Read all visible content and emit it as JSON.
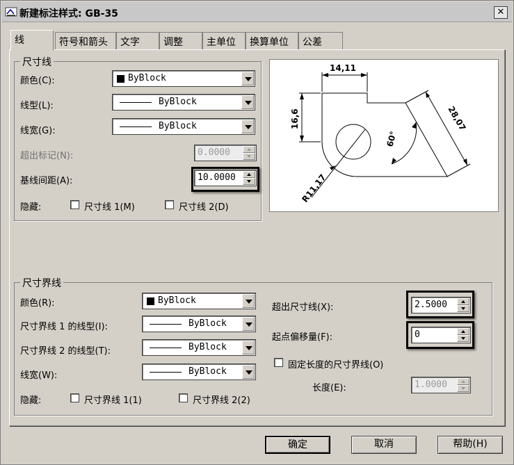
{
  "window": {
    "title": "新建标注样式: GB-35",
    "close_label": "✕"
  },
  "tabs": [
    {
      "label": "线"
    },
    {
      "label": "符号和箭头"
    },
    {
      "label": "文字"
    },
    {
      "label": "调整"
    },
    {
      "label": "主单位"
    },
    {
      "label": "换算单位"
    },
    {
      "label": "公差"
    }
  ],
  "dim_lines": {
    "legend": "尺寸线",
    "color_label": "颜色(C):",
    "color_value": "ByBlock",
    "linetype_label": "线型(L):",
    "linetype_value": "ByBlock",
    "lineweight_label": "线宽(G):",
    "lineweight_value": "ByBlock",
    "extend_ticks_label": "超出标记(N):",
    "extend_ticks_value": "0.0000",
    "baseline_spacing_label": "基线间距(A):",
    "baseline_spacing_value": "10.0000",
    "suppress_label": "隐藏:",
    "suppress_1": "尺寸线 1(M)",
    "suppress_2": "尺寸线 2(D)"
  },
  "preview": {
    "labels": [
      "14,11",
      "16,6",
      "28,07",
      "60°",
      "R11,17"
    ]
  },
  "ext_lines": {
    "legend": "尺寸界线",
    "color_label": "颜色(R):",
    "color_value": "ByBlock",
    "linetype1_label": "尺寸界线 1 的线型(I):",
    "linetype1_value": "ByBlock",
    "linetype2_label": "尺寸界线 2 的线型(T):",
    "linetype2_value": "ByBlock",
    "lineweight_label": "线宽(W):",
    "lineweight_value": "ByBlock",
    "suppress_label": "隐藏:",
    "suppress_1": "尺寸界线 1(1)",
    "suppress_2": "尺寸界线 2(2)",
    "extend_beyond_label": "超出尺寸线(X):",
    "extend_beyond_value": "2.5000",
    "offset_label": "起点偏移量(F):",
    "offset_value": "0",
    "fixed_length_label": "固定长度的尺寸界线(O)",
    "length_label": "长度(E):",
    "length_value": "1.0000"
  },
  "buttons": {
    "ok": "确定",
    "cancel": "取消",
    "help": "帮助(H)"
  }
}
